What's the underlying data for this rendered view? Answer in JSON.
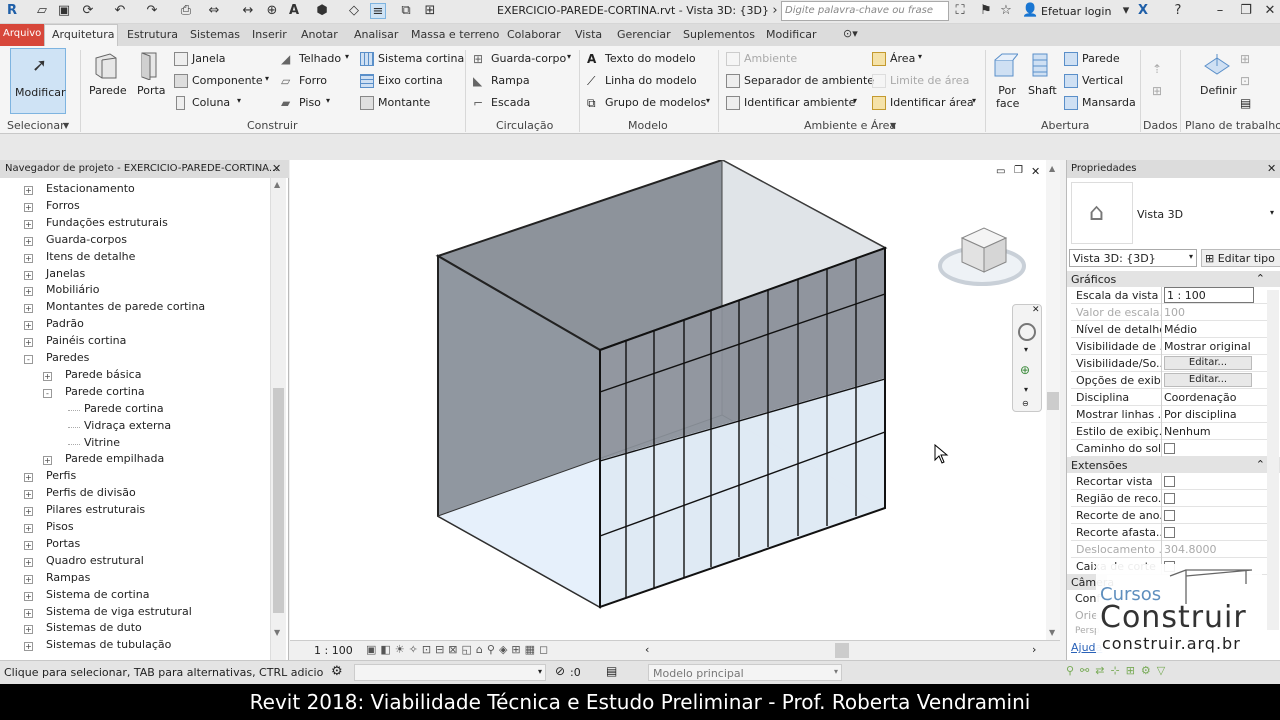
{
  "titlebar": {
    "doc_title": "EXERCICIO-PAREDE-CORTINA.rvt - Vista 3D: {3D}",
    "search_placeholder": "Digite palavra-chave ou frase",
    "login": "Efetuar login"
  },
  "tabs": [
    "Arquivo",
    "Arquitetura",
    "Estrutura",
    "Sistemas",
    "Inserir",
    "Anotar",
    "Analisar",
    "Massa e terreno",
    "Colaborar",
    "Vista",
    "Gerenciar",
    "Suplementos",
    "Modificar"
  ],
  "ribbon": {
    "modify": "Modificar",
    "select": "Selecionar",
    "build": {
      "parede": "Parede",
      "porta": "Porta",
      "janela": "Janela",
      "componente": "Componente",
      "coluna": "Coluna",
      "telhado": "Telhado",
      "forro": "Forro",
      "piso": "Piso",
      "sistema_cortina": "Sistema cortina",
      "eixo_cortina": "Eixo cortina",
      "montante": "Montante",
      "label": "Construir"
    },
    "circ": {
      "guarda_corpo": "Guarda-corpo",
      "rampa": "Rampa",
      "escada": "Escada",
      "label": "Circulação"
    },
    "model": {
      "texto": "Texto do modelo",
      "linha": "Linha do modelo",
      "grupo": "Grupo de modelos",
      "label": "Modelo"
    },
    "room": {
      "ambiente": "Ambiente",
      "separador": "Separador de ambiente",
      "identificar_ambiente": "Identificar ambiente",
      "area": "Área",
      "limite_area": "Limite de área",
      "identificar_area": "Identificar área",
      "label": "Ambiente e Área"
    },
    "opening": {
      "por_face": "Por face",
      "shaft": "Shaft",
      "parede": "Parede",
      "vertical": "Vertical",
      "mansarda": "Mansarda",
      "label": "Abertura"
    },
    "datum": {
      "label": "Dados"
    },
    "workplane": {
      "definir": "Definir",
      "label": "Plano de trabalho"
    }
  },
  "browser": {
    "title": "Navegador de projeto - EXERCICIO-PAREDE-CORTINA...",
    "items": [
      {
        "label": "Estacionamento",
        "level": 0,
        "sign": "+"
      },
      {
        "label": "Forros",
        "level": 0,
        "sign": "+"
      },
      {
        "label": "Fundações estruturais",
        "level": 0,
        "sign": "+"
      },
      {
        "label": "Guarda-corpos",
        "level": 0,
        "sign": "+"
      },
      {
        "label": "Itens de detalhe",
        "level": 0,
        "sign": "+"
      },
      {
        "label": "Janelas",
        "level": 0,
        "sign": "+"
      },
      {
        "label": "Mobiliário",
        "level": 0,
        "sign": "+"
      },
      {
        "label": "Montantes de parede cortina",
        "level": 0,
        "sign": "+"
      },
      {
        "label": "Padrão",
        "level": 0,
        "sign": "+"
      },
      {
        "label": "Painéis cortina",
        "level": 0,
        "sign": "+"
      },
      {
        "label": "Paredes",
        "level": 0,
        "sign": "-"
      },
      {
        "label": "Parede básica",
        "level": 1,
        "sign": "+"
      },
      {
        "label": "Parede cortina",
        "level": 1,
        "sign": "-"
      },
      {
        "label": "Parede cortina",
        "level": 2,
        "sign": ""
      },
      {
        "label": "Vidraça externa",
        "level": 2,
        "sign": ""
      },
      {
        "label": "Vitrine",
        "level": 2,
        "sign": ""
      },
      {
        "label": "Parede empilhada",
        "level": 1,
        "sign": "+"
      },
      {
        "label": "Perfis",
        "level": 0,
        "sign": "+"
      },
      {
        "label": "Perfis de divisão",
        "level": 0,
        "sign": "+"
      },
      {
        "label": "Pilares estruturais",
        "level": 0,
        "sign": "+"
      },
      {
        "label": "Pisos",
        "level": 0,
        "sign": "+"
      },
      {
        "label": "Portas",
        "level": 0,
        "sign": "+"
      },
      {
        "label": "Quadro estrutural",
        "level": 0,
        "sign": "+"
      },
      {
        "label": "Rampas",
        "level": 0,
        "sign": "+"
      },
      {
        "label": "Sistema de cortina",
        "level": 0,
        "sign": "+"
      },
      {
        "label": "Sistema de viga estrutural",
        "level": 0,
        "sign": "+"
      },
      {
        "label": "Sistemas de duto",
        "level": 0,
        "sign": "+"
      },
      {
        "label": "Sistemas de tubulação",
        "level": 0,
        "sign": "+"
      }
    ]
  },
  "viewport": {
    "scale": "1 : 100"
  },
  "properties": {
    "title": "Propriedades",
    "type_name": "Vista 3D",
    "view_select": "Vista 3D: {3D}",
    "edit_type": "Editar tipo",
    "graphics": "Gráficos",
    "extents": "Extensões",
    "camera": "Câmera",
    "rows_graphics": [
      {
        "key": "Escala da vista",
        "value": "1 : 100",
        "kind": "input"
      },
      {
        "key": "Valor de escala...",
        "value": "100",
        "kind": "disabled"
      },
      {
        "key": "Nível de detalhe",
        "value": "Médio",
        "kind": "text"
      },
      {
        "key": "Visibilidade de ...",
        "value": "Mostrar original",
        "kind": "text"
      },
      {
        "key": "Visibilidade/So...",
        "value": "Editar...",
        "kind": "button"
      },
      {
        "key": "Opções de exib...",
        "value": "Editar...",
        "kind": "button"
      },
      {
        "key": "Disciplina",
        "value": "Coordenação",
        "kind": "text"
      },
      {
        "key": "Mostrar linhas ...",
        "value": "Por disciplina",
        "kind": "text"
      },
      {
        "key": "Estilo de exibiç...",
        "value": "Nenhum",
        "kind": "text"
      },
      {
        "key": "Caminho do sol",
        "value": "",
        "kind": "check"
      }
    ],
    "rows_extents": [
      {
        "key": "Recortar vista",
        "value": "",
        "kind": "check"
      },
      {
        "key": "Região de reco...",
        "value": "",
        "kind": "check"
      },
      {
        "key": "Recorte de ano...",
        "value": "",
        "kind": "check"
      },
      {
        "key": "Recorte afasta...",
        "value": "",
        "kind": "check"
      },
      {
        "key": "Deslocamento ...",
        "value": "304.8000",
        "kind": "disabled"
      },
      {
        "key": "Caixa de corte",
        "value": "",
        "kind": "check"
      }
    ],
    "rows_camera": [
      "Conf",
      "Orie",
      "Persp"
    ],
    "help": "Ajuda"
  },
  "status": {
    "hint": "Clique para selecionar, TAB para alternativas, CTRL adiciona, SHIF",
    "count": ":0",
    "model": "Modelo principal"
  },
  "caption": "Revit 2018: Viabilidade Técnica e Estudo Preliminar - Prof. Roberta Vendramini",
  "logo": {
    "top": "Cursos",
    "main": "Construir",
    "url": "construir.arq.br"
  }
}
